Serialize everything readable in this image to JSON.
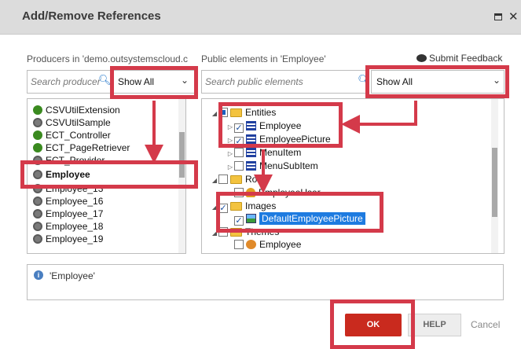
{
  "window": {
    "title": "Add/Remove References",
    "maximize_icon": "maximize-icon",
    "close_glyph": "✕"
  },
  "producers": {
    "label": "Producers in 'demo.outsystemscloud.c",
    "search_placeholder": "Search producer",
    "filter_value": "Show All",
    "items": [
      {
        "name": "CSVUtilExtension",
        "icon": "extension-icon"
      },
      {
        "name": "CSVUtilSample",
        "icon": "module-icon"
      },
      {
        "name": "ECT_Controller",
        "icon": "extension-icon"
      },
      {
        "name": "ECT_PageRetriever",
        "icon": "extension-icon"
      },
      {
        "name": "ECT_Provider",
        "icon": "module-icon"
      },
      {
        "name": "Employee",
        "icon": "module-icon"
      },
      {
        "name": "Employee_13",
        "icon": "module-icon"
      },
      {
        "name": "Employee_16",
        "icon": "module-icon"
      },
      {
        "name": "Employee_17",
        "icon": "module-icon"
      },
      {
        "name": "Employee_18",
        "icon": "module-icon"
      },
      {
        "name": "Employee_19",
        "icon": "module-icon"
      }
    ]
  },
  "public_elements": {
    "label": "Public elements in 'Employee'",
    "search_placeholder": "Search public elements",
    "filter_value": "Show All",
    "tree": {
      "entities": "Entities",
      "employee": "Employee",
      "employee_picture": "EmployeePicture",
      "menu_item": "MenuItem",
      "menu_sub_item": "MenuSubItem",
      "roles": "Roles",
      "employee_user": "EmployeeUser",
      "images": "Images",
      "default_employee_picture": "DefaultEmployeePicture",
      "themes": "Themes",
      "theme_employee": "Employee"
    }
  },
  "feedback": "Submit Feedback",
  "info": {
    "text": "'Employee'"
  },
  "buttons": {
    "ok": "OK",
    "help": "HELP",
    "cancel": "Cancel"
  },
  "colors": {
    "highlight": "#d43a4a",
    "ok_button": "#c92a1e",
    "selection": "#1e7be0"
  }
}
